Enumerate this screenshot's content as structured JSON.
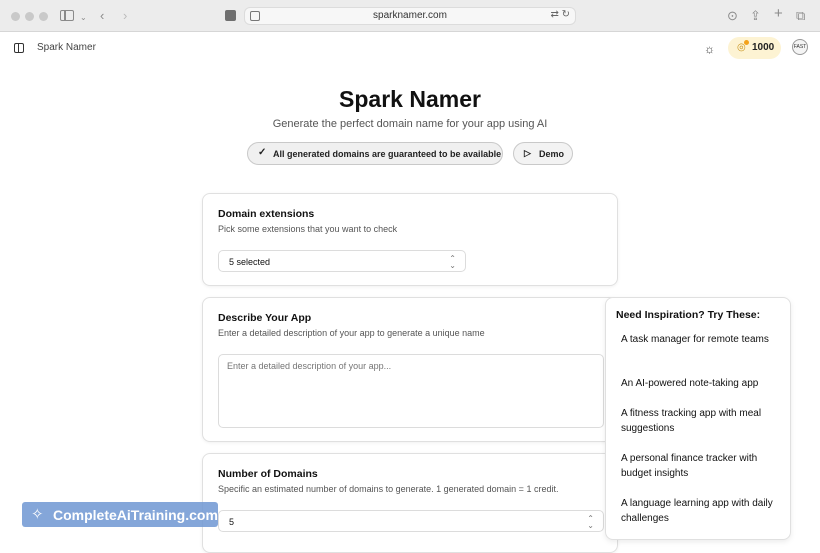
{
  "browser": {
    "url": "sparknamer.com"
  },
  "header": {
    "app_name": "Spark Namer",
    "credits": "1000",
    "avatar_text": "FAST"
  },
  "hero": {
    "title": "Spark Namer",
    "subtitle": "Generate the perfect domain name for your app using AI",
    "guarantee_label": "All generated domains are guaranteed to be available",
    "demo_label": "Demo"
  },
  "domain_extensions": {
    "title": "Domain extensions",
    "description": "Pick some extensions that you want to check",
    "selected_value": "5 selected"
  },
  "describe_app": {
    "title": "Describe Your App",
    "description": "Enter a detailed description of your app to generate a unique name",
    "placeholder": "Enter a detailed description of your app..."
  },
  "number_of_domains": {
    "title": "Number of Domains",
    "description": "Specific an estimated number of domains to generate. 1 generated domain = 1 credit.",
    "value": "5"
  },
  "inspiration": {
    "title": "Need Inspiration? Try These:",
    "items": [
      "A task manager for remote teams",
      "An AI-powered note-taking app",
      "A fitness tracking app with meal suggestions",
      "A personal finance tracker with budget insights",
      "A language learning app with daily challenges"
    ]
  },
  "watermark": {
    "text": "CompleteAiTraining.com"
  },
  "icons": {
    "sidebar": "sidebar-icon",
    "theme": "sun-icon",
    "credits": "coins-icon",
    "check": "check-icon",
    "play": "play-icon",
    "chevrons": "chevron-up-down-icon"
  }
}
